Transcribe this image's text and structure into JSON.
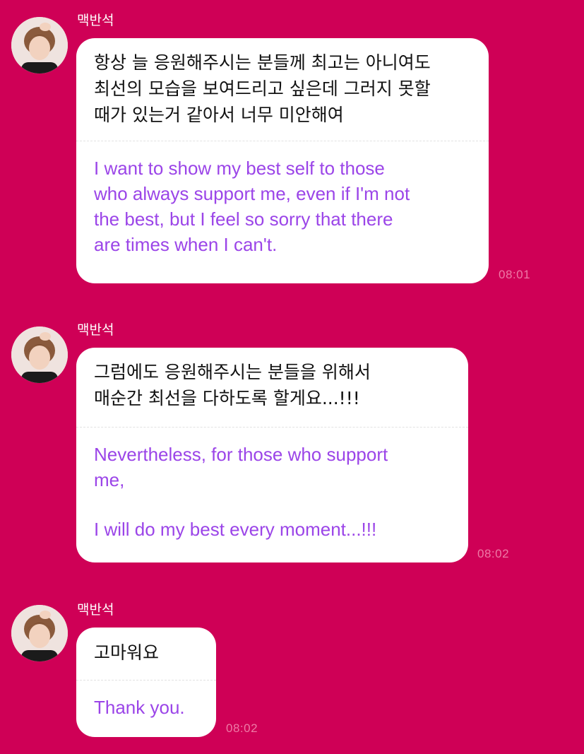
{
  "chat": {
    "messages": [
      {
        "sender": "맥반석",
        "korean_lines": [
          "항상 늘 응원해주시는 분들께 최고는 아니여도",
          "최선의 모습을 보여드리고 싶은데 그러지 못할",
          "때가 있는거 같아서 너무 미안해여"
        ],
        "translation_lines": [
          "I want to show my best self to those",
          "who always support me, even if I'm not",
          "the best, but I feel so sorry that there",
          "are times when I can't."
        ],
        "time": "08:01"
      },
      {
        "sender": "맥반석",
        "korean_lines": [
          "그럼에도 응원해주시는 분들을 위해서",
          "매순간 최선을 다하도록 할게요...!!!"
        ],
        "translation_lines": [
          "Nevertheless, for those who support",
          "me,",
          "I will do my best every moment...!!!"
        ],
        "time": "08:02"
      },
      {
        "sender": "맥반석",
        "korean_lines": [
          "고마워요"
        ],
        "translation_lines": [
          "Thank you."
        ],
        "time": "08:02"
      }
    ]
  },
  "colors": {
    "background": "#cf0056",
    "bubble": "#ffffff",
    "translation_text": "#9b45e8",
    "timestamp": "#ee7aa6"
  },
  "icons": {
    "avatar": "profile-photo-avatar"
  }
}
